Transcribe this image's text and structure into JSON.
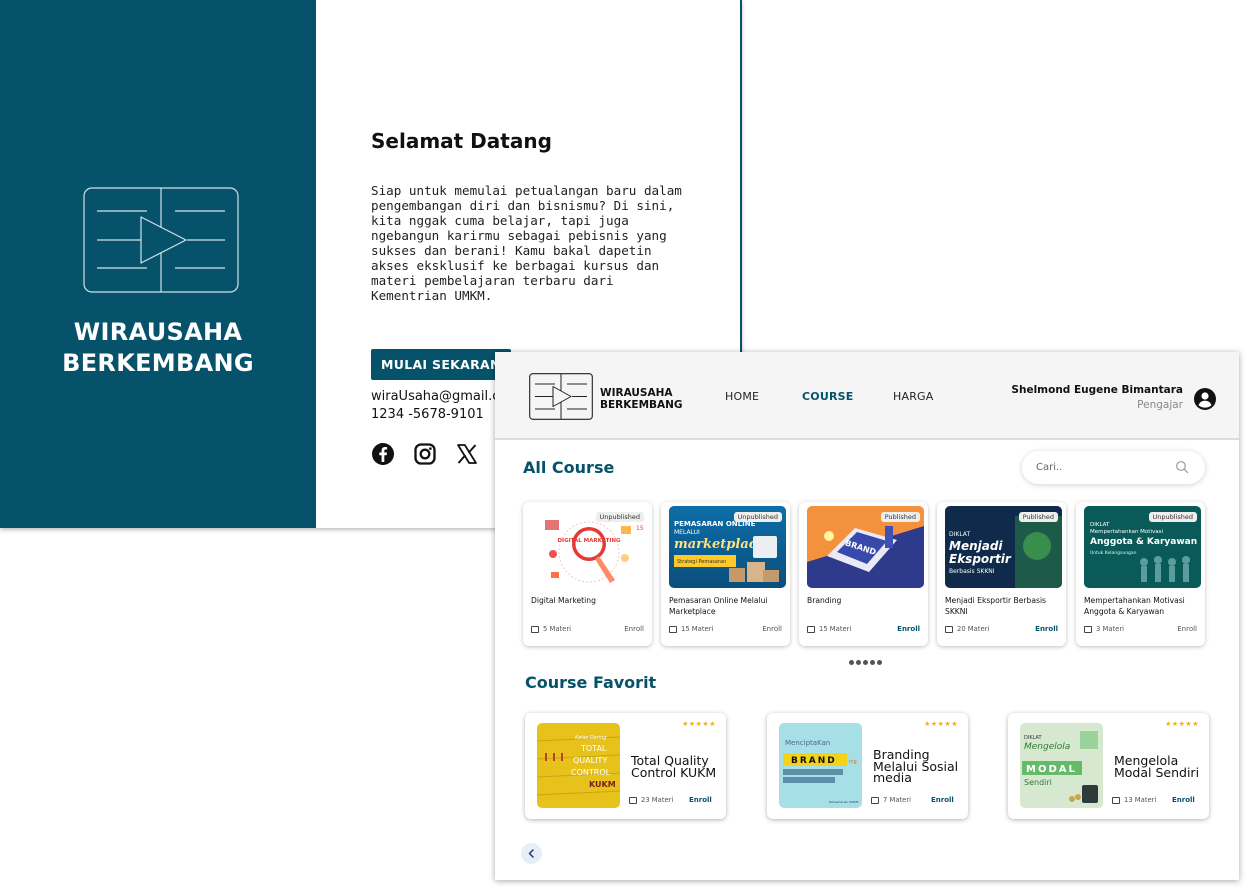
{
  "landing": {
    "brand_line1": "WIRAUSAHA",
    "brand_line2": "BERKEMBANG",
    "welcome_title": "Selamat Datang",
    "welcome_body": "Siap untuk memulai petualangan baru dalam pengembangan diri dan bisnismu? Di sini, kita nggak cuma belajar, tapi juga ngebangun karirmu sebagai pebisnis yang sukses dan berani! Kamu bakal dapetin akses eksklusif ke berbagai kursus dan materi pembelajaran terbaru dari Kementrian UMKM.",
    "cta_label": "MULAI SEKARANG",
    "email": "wiraUsaha@gmail.com",
    "phone": "1234 -5678-9101",
    "social_icons": [
      "facebook-icon",
      "instagram-icon",
      "x-icon"
    ],
    "colors": {
      "primary": "#06526a"
    }
  },
  "dashboard": {
    "brand_line1": "WIRAUSAHA",
    "brand_line2": "BERKEMBANG",
    "nav": {
      "home": "HOME",
      "course": "COURSE",
      "harga": "HARGA",
      "active": "COURSE"
    },
    "user": {
      "name": "Shelmond Eugene Bimantara",
      "role": "Pengajar",
      "icon": "user-circle-icon"
    },
    "all_course_title": "All Course",
    "search_placeholder": "Cari..",
    "courses": [
      {
        "title": "Digital Marketing",
        "status": "Unpublished",
        "materi": "5 Materi",
        "enroll": "Enroll",
        "thumb_text": "DIGITAL MARKETING"
      },
      {
        "title": "Pemasaran Online Melalui Marketplace",
        "status": "Unpublished",
        "materi": "15 Materi",
        "enroll": "Enroll",
        "thumb_text": "PEMASARAN ONLINE MELALUI marketplace"
      },
      {
        "title": "Branding",
        "status": "Published",
        "materi": "15 Materi",
        "enroll": "Enroll",
        "thumb_text": "BRAND"
      },
      {
        "title": "Menjadi Eksportir Berbasis SKKNI",
        "status": "Published",
        "materi": "20 Materi",
        "enroll": "Enroll",
        "thumb_text": "Menjadi Eksportir"
      },
      {
        "title": "Mempertahankan Motivasi Anggota & Karyawan",
        "status": "Unpublished",
        "materi": "3 Materi",
        "enroll": "Enroll",
        "thumb_text": "Anggota & Karyawan"
      }
    ],
    "carousel_dots": 5,
    "favorit_title": "Course Favorit",
    "favorites": [
      {
        "title": "Total Quality Control KUKM",
        "stars": "★★★★★",
        "materi": "23 Materi",
        "enroll": "Enroll",
        "thumb_text": "QUALITY CONTROL"
      },
      {
        "title": "Branding Melalui Sosial media",
        "stars": "★★★★★",
        "materi": "7 Materi",
        "enroll": "Enroll",
        "thumb_text": "BRAND"
      },
      {
        "title": "Mengelola Modal Sendiri",
        "stars": "★★★★★",
        "materi": "13 Materi",
        "enroll": "Enroll",
        "thumb_text": "MODAL"
      }
    ],
    "prev_icon": "chevron-left-icon"
  }
}
